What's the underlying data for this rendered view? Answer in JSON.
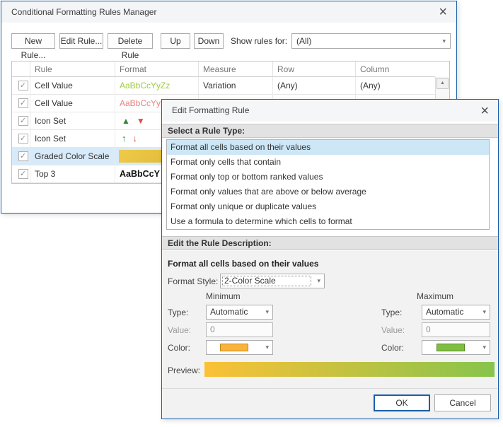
{
  "icons": {
    "close": "×",
    "caret_down": "▾",
    "check": "✓",
    "scroll_up": "▲",
    "triangle_up": "▲",
    "triangle_down": "▼",
    "arrow_up": "↑",
    "arrow_down": "↓"
  },
  "colors": {
    "dialog_border": "#1A5FA8",
    "list_selection": "#CDE7F7",
    "row_selection": "#D7EAF9",
    "section_band": "#E2E2E2",
    "green_text": "#9FCC3F",
    "red_text": "#EC8181",
    "icon_green": "#36823B",
    "icon_red": "#E14C4C",
    "min_swatch": "#F9B33B",
    "max_swatch": "#7FBE41",
    "preview_gradient_start": "#FBC136",
    "preview_gradient_end": "#87C44C",
    "graded_swatch_start": "#EFCB49",
    "graded_swatch_end": "#DCB433"
  },
  "manager_dialog": {
    "title": "Conditional Formatting Rules Manager",
    "toolbar": {
      "new_rule": "New Rule...",
      "edit_rule": "Edit Rule...",
      "delete_rule": "Delete Rule",
      "up": "Up",
      "down": "Down",
      "show_rules_for_label": "Show rules for:",
      "show_rules_for_value": "(All)"
    },
    "table": {
      "headers": {
        "check": "",
        "rule": "Rule",
        "format": "Format",
        "measure": "Measure",
        "row": "Row",
        "column": "Column"
      },
      "rows": [
        {
          "checked": true,
          "rule": "Cell Value",
          "format_text": "AaBbCcYyZz",
          "format_kind": "text-green",
          "measure": "Variation",
          "row": "(Any)",
          "column": "(Any)"
        },
        {
          "checked": true,
          "rule": "Cell Value",
          "format_text": "AaBbCcYy",
          "format_kind": "text-red"
        },
        {
          "checked": true,
          "rule": "Icon Set",
          "format_kind": "triangles"
        },
        {
          "checked": true,
          "rule": "Icon Set",
          "format_kind": "arrows"
        },
        {
          "checked": true,
          "rule": "Graded Color Scale",
          "format_kind": "gradient-swatch",
          "selected": true
        },
        {
          "checked": true,
          "rule": "Top 3",
          "format_text": "AaBbCcY",
          "format_kind": "text-bold"
        }
      ]
    }
  },
  "edit_dialog": {
    "title": "Edit Formatting Rule",
    "rule_types": {
      "header": "Select a Rule Type:",
      "selected_index": 0,
      "options": [
        "Format all cells based on their values",
        "Format only cells that contain",
        "Format only top or bottom ranked values",
        "Format only values that are above or below average",
        "Format only unique or duplicate values",
        "Use a formula to determine which cells to format"
      ]
    },
    "description": {
      "header": "Edit the Rule Description:",
      "subtitle": "Format all cells based on their values",
      "format_style_label": "Format Style:",
      "format_style_value": "2-Color Scale",
      "minimum": {
        "header": "Minimum",
        "type_label": "Type:",
        "type_value": "Automatic",
        "value_label": "Value:",
        "value": "0",
        "color_label": "Color:",
        "color": "#F9B33B"
      },
      "maximum": {
        "header": "Maximum",
        "type_label": "Type:",
        "type_value": "Automatic",
        "value_label": "Value:",
        "value": "0",
        "color_label": "Color:",
        "color": "#7FBE41"
      },
      "preview_label": "Preview:"
    },
    "footer": {
      "ok": "OK",
      "cancel": "Cancel"
    }
  }
}
